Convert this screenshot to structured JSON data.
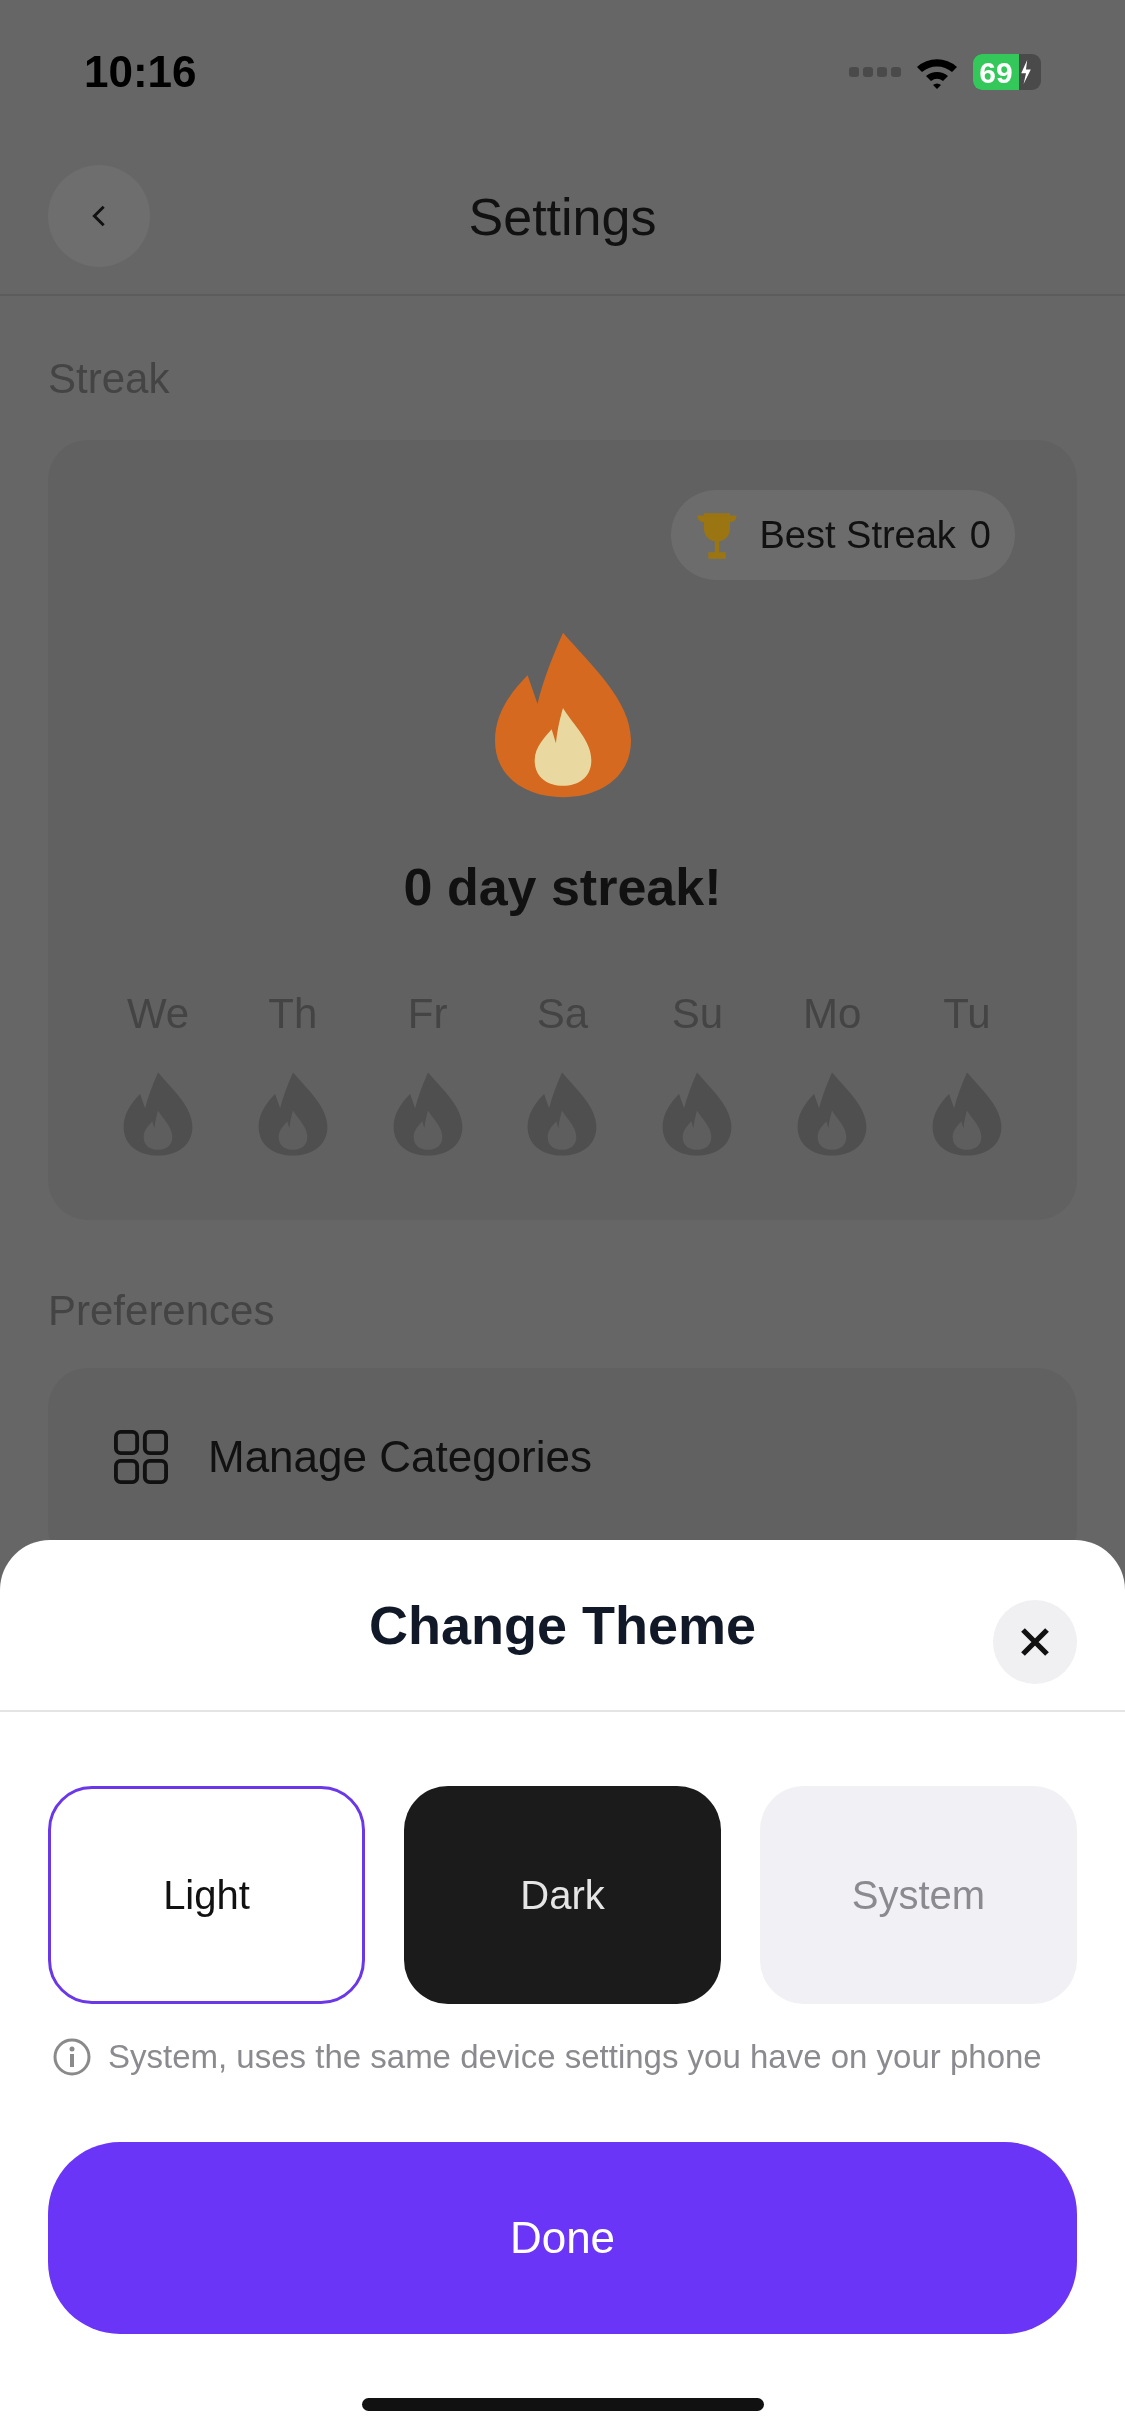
{
  "status_bar": {
    "time": "10:16",
    "battery": "69"
  },
  "header": {
    "title": "Settings"
  },
  "streak": {
    "label": "Streak",
    "best_streak": {
      "label": "Best Streak",
      "value": "0"
    },
    "headline": "0 day streak!",
    "days": [
      {
        "label": "We",
        "lit": false
      },
      {
        "label": "Th",
        "lit": false
      },
      {
        "label": "Fr",
        "lit": false
      },
      {
        "label": "Sa",
        "lit": false
      },
      {
        "label": "Su",
        "lit": false
      },
      {
        "label": "Mo",
        "lit": false
      },
      {
        "label": "Tu",
        "lit": false
      }
    ]
  },
  "preferences": {
    "label": "Preferences",
    "items": [
      {
        "label": "Manage Categories"
      }
    ]
  },
  "sheet": {
    "title": "Change Theme",
    "options": [
      {
        "label": "Light",
        "kind": "light",
        "selected": true
      },
      {
        "label": "Dark",
        "kind": "dark",
        "selected": false
      },
      {
        "label": "System",
        "kind": "system",
        "selected": false
      }
    ],
    "note": "System, uses the same device settings you have on your phone",
    "done": "Done"
  }
}
